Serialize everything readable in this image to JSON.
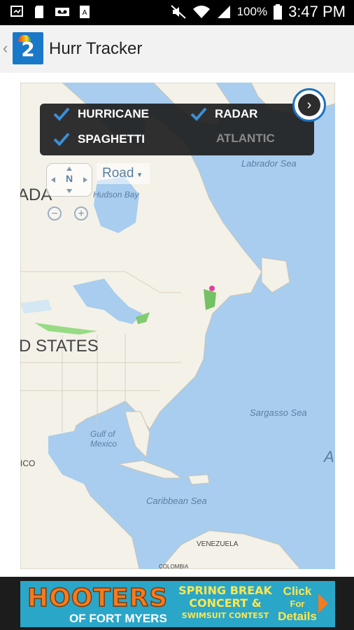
{
  "status_bar": {
    "battery_percent": "100%",
    "time": "3:47 PM",
    "left_icons": [
      "screenshot-icon",
      "sd-card-icon",
      "voicemail-icon",
      "keyboard-icon"
    ],
    "right_icons": [
      "mute-icon",
      "wifi-icon",
      "signal-icon",
      "battery-icon"
    ]
  },
  "app_bar": {
    "back_icon": "chevron-left-icon",
    "logo_text": "2",
    "title": "Hurr Tracker"
  },
  "layers_panel": {
    "options": [
      {
        "label": "HURRICANE",
        "checked": true
      },
      {
        "label": "RADAR",
        "checked": true
      },
      {
        "label": "SPAGHETTI",
        "checked": true
      },
      {
        "label": "ATLANTIC",
        "checked": false
      }
    ],
    "next_icon": "chevron-right-icon"
  },
  "map_controls": {
    "compass_label": "N",
    "map_style": "Road",
    "zoom_out_icon": "zoom-out-icon",
    "zoom_in_icon": "zoom-in-icon"
  },
  "map_labels": {
    "canada": "ADA",
    "labrador_sea": "Labrador Sea",
    "hudson_bay": "Hudson Bay",
    "united_states": "D STATES",
    "sargasso_sea": "Sargasso Sea",
    "gulf_line1": "Gulf of",
    "gulf_line2": "Mexico",
    "mexico": "ICO",
    "caribbean_sea": "Caribbean Sea",
    "venezuela": "VENEZUELA",
    "colombia": "COLOMBIA",
    "atlantic_edge": "A"
  },
  "ad_banner": {
    "brand": "HOOTERS",
    "location": "OF FORT MYERS",
    "line1": "SPRING BREAK",
    "line2": "CONCERT &",
    "line3": "SWIMSUIT CONTEST",
    "cta1": "Click",
    "cta2": "For",
    "cta3": "Details"
  },
  "colors": {
    "status_bar": "#000000",
    "app_bar": "#f2f2f2",
    "ocean": "#a8cdee",
    "land": "#f4f1e8",
    "panel": "#1e1e1e",
    "check": "#3a8fd8",
    "ad_background": "#2aa6c8",
    "ad_brand": "#f47b20",
    "ad_text": "#ffe64d"
  }
}
